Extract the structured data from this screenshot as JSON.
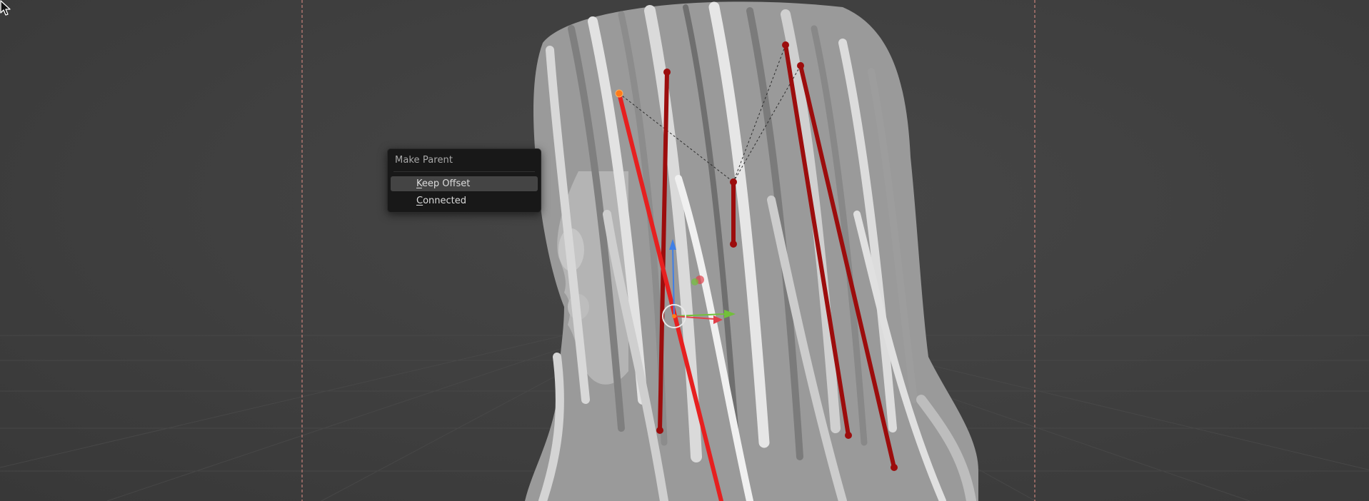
{
  "context_menu": {
    "title": "Make Parent",
    "items": [
      {
        "mnemonic": "K",
        "rest": "eep Offset",
        "highlighted": true
      },
      {
        "mnemonic": "C",
        "rest": "onnected",
        "highlighted": false
      }
    ]
  },
  "colors": {
    "viewport_bg": "#3d3d3d",
    "grid_line": "#4a4a4a",
    "camera_frame": "#c9827a",
    "bone": "#9c0d0d",
    "bone_selected": "#e62020",
    "bone_active_joint": "#ff7a1a",
    "menu_bg": "#181818",
    "menu_highlight": "#444444",
    "gizmo_x": "#e0404a",
    "gizmo_y": "#72c03a",
    "gizmo_z": "#3f7fe6"
  },
  "icons": [
    "mouse-cursor-icon",
    "transform-gizmo-icon",
    "pivot-circle-icon"
  ]
}
